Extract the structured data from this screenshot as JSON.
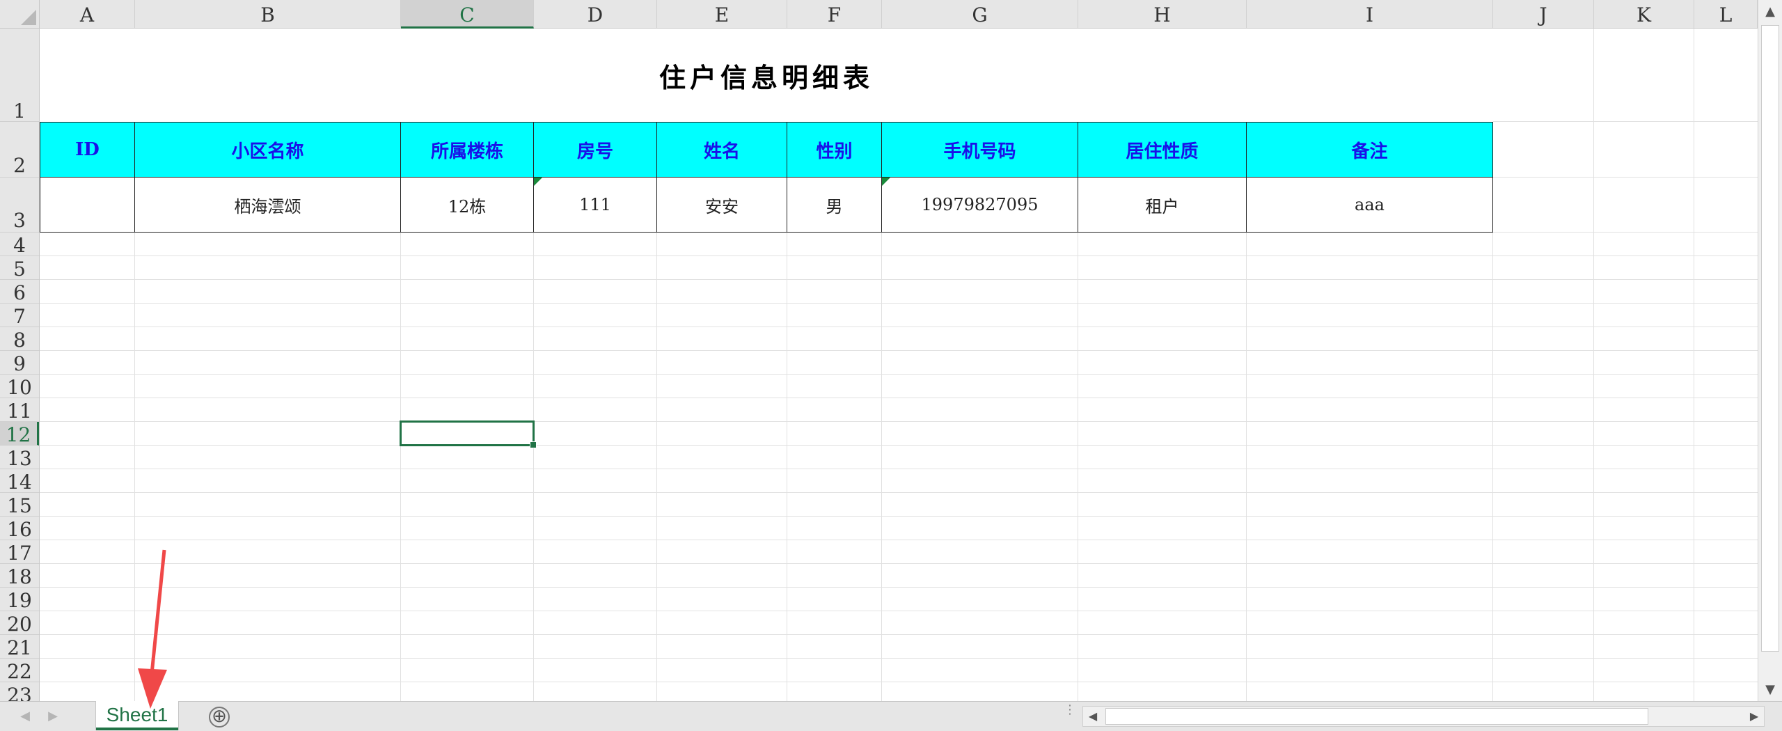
{
  "columns": [
    "A",
    "B",
    "C",
    "D",
    "E",
    "F",
    "G",
    "H",
    "I",
    "J",
    "K",
    "L"
  ],
  "active_column": "C",
  "rows": [
    "1",
    "2",
    "3",
    "4",
    "5",
    "6",
    "7",
    "8",
    "9",
    "10",
    "11",
    "12",
    "13",
    "14",
    "15",
    "16",
    "17",
    "18",
    "19",
    "20",
    "21",
    "22",
    "23"
  ],
  "active_row": "12",
  "title": "住户信息明细表",
  "headers": [
    "ID",
    "小区名称",
    "所属楼栋",
    "房号",
    "姓名",
    "性别",
    "手机号码",
    "居住性质",
    "备注"
  ],
  "data_row": [
    "",
    "栖海澐颂",
    "12栋",
    "111",
    "安安",
    "男",
    "19979827095",
    "租户",
    "aaa"
  ],
  "sheet_tab": "Sheet1",
  "add_sheet_symbol": "⊕",
  "colors": {
    "header_fill": "#00ffff",
    "header_text": "#1a10e8",
    "accent": "#217346",
    "annotation_arrow": "#f04848"
  },
  "icons": {
    "scroll_up": "▲",
    "scroll_down": "▼",
    "scroll_left": "◀",
    "scroll_right": "▶",
    "tab_prev": "◀",
    "tab_next": "▶"
  }
}
